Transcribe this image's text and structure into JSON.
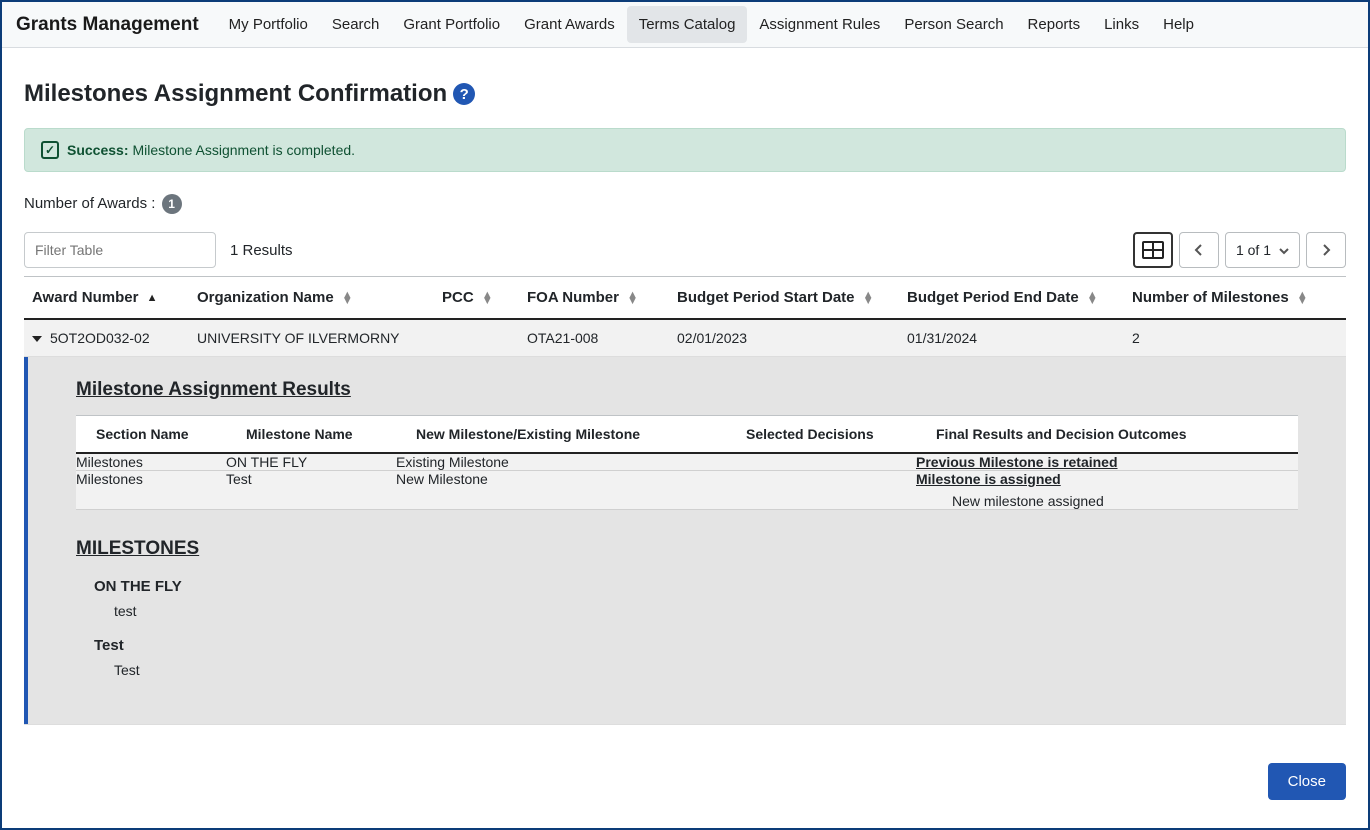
{
  "brand": "Grants Management",
  "nav": [
    {
      "label": "My Portfolio",
      "active": false
    },
    {
      "label": "Search",
      "active": false
    },
    {
      "label": "Grant Portfolio",
      "active": false
    },
    {
      "label": "Grant Awards",
      "active": false
    },
    {
      "label": "Terms Catalog",
      "active": true
    },
    {
      "label": "Assignment Rules",
      "active": false
    },
    {
      "label": "Person Search",
      "active": false
    },
    {
      "label": "Reports",
      "active": false
    },
    {
      "label": "Links",
      "active": false
    },
    {
      "label": "Help",
      "active": false
    }
  ],
  "page_title": "Milestones Assignment Confirmation",
  "alert": {
    "prefix": "Success:",
    "message": "Milestone Assignment is completed."
  },
  "awards_label": "Number of Awards :",
  "awards_count": "1",
  "filter_placeholder": "Filter Table",
  "results_text": "1 Results",
  "page_indicator": "1 of 1",
  "columns": [
    "Award Number",
    "Organization Name",
    "PCC",
    "FOA Number",
    "Budget Period Start Date",
    "Budget Period End Date",
    "Number of Milestones"
  ],
  "row": {
    "award_number": "5OT2OD032-02",
    "organization": "UNIVERSITY OF ILVERMORNY",
    "pcc": "",
    "foa": "OTA21-008",
    "bp_start": "02/01/2023",
    "bp_end": "01/31/2024",
    "num_milestones": "2"
  },
  "detail": {
    "results_title": "Milestone Assignment Results",
    "inner_columns": [
      "Section Name",
      "Milestone Name",
      "New Milestone/Existing Milestone",
      "Selected Decisions",
      "Final Results and Decision Outcomes"
    ],
    "inner_rows": [
      {
        "section": "Milestones",
        "milestone": "ON THE FLY",
        "type": "Existing Milestone",
        "decisions": "",
        "final_main": "Previous Milestone is retained",
        "final_sub": ""
      },
      {
        "section": "Milestones",
        "milestone": "Test",
        "type": "New Milestone",
        "decisions": "",
        "final_main": "Milestone is assigned",
        "final_sub": "New milestone assigned"
      }
    ],
    "milestones_title": "MILESTONES",
    "milestones": [
      {
        "name": "ON THE FLY",
        "desc": "test"
      },
      {
        "name": "Test",
        "desc": "Test"
      }
    ]
  },
  "close_label": "Close"
}
